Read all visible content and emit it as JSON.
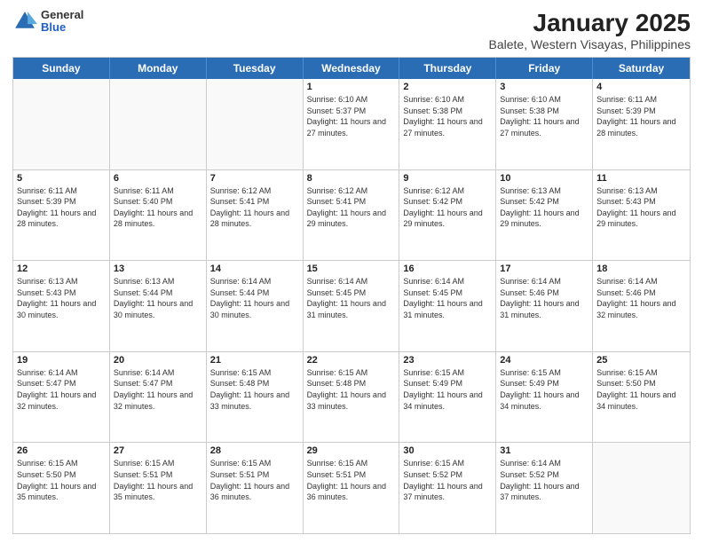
{
  "logo": {
    "general": "General",
    "blue": "Blue"
  },
  "title": "January 2025",
  "subtitle": "Balete, Western Visayas, Philippines",
  "days": [
    "Sunday",
    "Monday",
    "Tuesday",
    "Wednesday",
    "Thursday",
    "Friday",
    "Saturday"
  ],
  "weeks": [
    [
      {
        "day": "",
        "sunrise": "",
        "sunset": "",
        "daylight": ""
      },
      {
        "day": "",
        "sunrise": "",
        "sunset": "",
        "daylight": ""
      },
      {
        "day": "",
        "sunrise": "",
        "sunset": "",
        "daylight": ""
      },
      {
        "day": "1",
        "sunrise": "Sunrise: 6:10 AM",
        "sunset": "Sunset: 5:37 PM",
        "daylight": "Daylight: 11 hours and 27 minutes."
      },
      {
        "day": "2",
        "sunrise": "Sunrise: 6:10 AM",
        "sunset": "Sunset: 5:38 PM",
        "daylight": "Daylight: 11 hours and 27 minutes."
      },
      {
        "day": "3",
        "sunrise": "Sunrise: 6:10 AM",
        "sunset": "Sunset: 5:38 PM",
        "daylight": "Daylight: 11 hours and 27 minutes."
      },
      {
        "day": "4",
        "sunrise": "Sunrise: 6:11 AM",
        "sunset": "Sunset: 5:39 PM",
        "daylight": "Daylight: 11 hours and 28 minutes."
      }
    ],
    [
      {
        "day": "5",
        "sunrise": "Sunrise: 6:11 AM",
        "sunset": "Sunset: 5:39 PM",
        "daylight": "Daylight: 11 hours and 28 minutes."
      },
      {
        "day": "6",
        "sunrise": "Sunrise: 6:11 AM",
        "sunset": "Sunset: 5:40 PM",
        "daylight": "Daylight: 11 hours and 28 minutes."
      },
      {
        "day": "7",
        "sunrise": "Sunrise: 6:12 AM",
        "sunset": "Sunset: 5:41 PM",
        "daylight": "Daylight: 11 hours and 28 minutes."
      },
      {
        "day": "8",
        "sunrise": "Sunrise: 6:12 AM",
        "sunset": "Sunset: 5:41 PM",
        "daylight": "Daylight: 11 hours and 29 minutes."
      },
      {
        "day": "9",
        "sunrise": "Sunrise: 6:12 AM",
        "sunset": "Sunset: 5:42 PM",
        "daylight": "Daylight: 11 hours and 29 minutes."
      },
      {
        "day": "10",
        "sunrise": "Sunrise: 6:13 AM",
        "sunset": "Sunset: 5:42 PM",
        "daylight": "Daylight: 11 hours and 29 minutes."
      },
      {
        "day": "11",
        "sunrise": "Sunrise: 6:13 AM",
        "sunset": "Sunset: 5:43 PM",
        "daylight": "Daylight: 11 hours and 29 minutes."
      }
    ],
    [
      {
        "day": "12",
        "sunrise": "Sunrise: 6:13 AM",
        "sunset": "Sunset: 5:43 PM",
        "daylight": "Daylight: 11 hours and 30 minutes."
      },
      {
        "day": "13",
        "sunrise": "Sunrise: 6:13 AM",
        "sunset": "Sunset: 5:44 PM",
        "daylight": "Daylight: 11 hours and 30 minutes."
      },
      {
        "day": "14",
        "sunrise": "Sunrise: 6:14 AM",
        "sunset": "Sunset: 5:44 PM",
        "daylight": "Daylight: 11 hours and 30 minutes."
      },
      {
        "day": "15",
        "sunrise": "Sunrise: 6:14 AM",
        "sunset": "Sunset: 5:45 PM",
        "daylight": "Daylight: 11 hours and 31 minutes."
      },
      {
        "day": "16",
        "sunrise": "Sunrise: 6:14 AM",
        "sunset": "Sunset: 5:45 PM",
        "daylight": "Daylight: 11 hours and 31 minutes."
      },
      {
        "day": "17",
        "sunrise": "Sunrise: 6:14 AM",
        "sunset": "Sunset: 5:46 PM",
        "daylight": "Daylight: 11 hours and 31 minutes."
      },
      {
        "day": "18",
        "sunrise": "Sunrise: 6:14 AM",
        "sunset": "Sunset: 5:46 PM",
        "daylight": "Daylight: 11 hours and 32 minutes."
      }
    ],
    [
      {
        "day": "19",
        "sunrise": "Sunrise: 6:14 AM",
        "sunset": "Sunset: 5:47 PM",
        "daylight": "Daylight: 11 hours and 32 minutes."
      },
      {
        "day": "20",
        "sunrise": "Sunrise: 6:14 AM",
        "sunset": "Sunset: 5:47 PM",
        "daylight": "Daylight: 11 hours and 32 minutes."
      },
      {
        "day": "21",
        "sunrise": "Sunrise: 6:15 AM",
        "sunset": "Sunset: 5:48 PM",
        "daylight": "Daylight: 11 hours and 33 minutes."
      },
      {
        "day": "22",
        "sunrise": "Sunrise: 6:15 AM",
        "sunset": "Sunset: 5:48 PM",
        "daylight": "Daylight: 11 hours and 33 minutes."
      },
      {
        "day": "23",
        "sunrise": "Sunrise: 6:15 AM",
        "sunset": "Sunset: 5:49 PM",
        "daylight": "Daylight: 11 hours and 34 minutes."
      },
      {
        "day": "24",
        "sunrise": "Sunrise: 6:15 AM",
        "sunset": "Sunset: 5:49 PM",
        "daylight": "Daylight: 11 hours and 34 minutes."
      },
      {
        "day": "25",
        "sunrise": "Sunrise: 6:15 AM",
        "sunset": "Sunset: 5:50 PM",
        "daylight": "Daylight: 11 hours and 34 minutes."
      }
    ],
    [
      {
        "day": "26",
        "sunrise": "Sunrise: 6:15 AM",
        "sunset": "Sunset: 5:50 PM",
        "daylight": "Daylight: 11 hours and 35 minutes."
      },
      {
        "day": "27",
        "sunrise": "Sunrise: 6:15 AM",
        "sunset": "Sunset: 5:51 PM",
        "daylight": "Daylight: 11 hours and 35 minutes."
      },
      {
        "day": "28",
        "sunrise": "Sunrise: 6:15 AM",
        "sunset": "Sunset: 5:51 PM",
        "daylight": "Daylight: 11 hours and 36 minutes."
      },
      {
        "day": "29",
        "sunrise": "Sunrise: 6:15 AM",
        "sunset": "Sunset: 5:51 PM",
        "daylight": "Daylight: 11 hours and 36 minutes."
      },
      {
        "day": "30",
        "sunrise": "Sunrise: 6:15 AM",
        "sunset": "Sunset: 5:52 PM",
        "daylight": "Daylight: 11 hours and 37 minutes."
      },
      {
        "day": "31",
        "sunrise": "Sunrise: 6:14 AM",
        "sunset": "Sunset: 5:52 PM",
        "daylight": "Daylight: 11 hours and 37 minutes."
      },
      {
        "day": "",
        "sunrise": "",
        "sunset": "",
        "daylight": ""
      }
    ]
  ]
}
